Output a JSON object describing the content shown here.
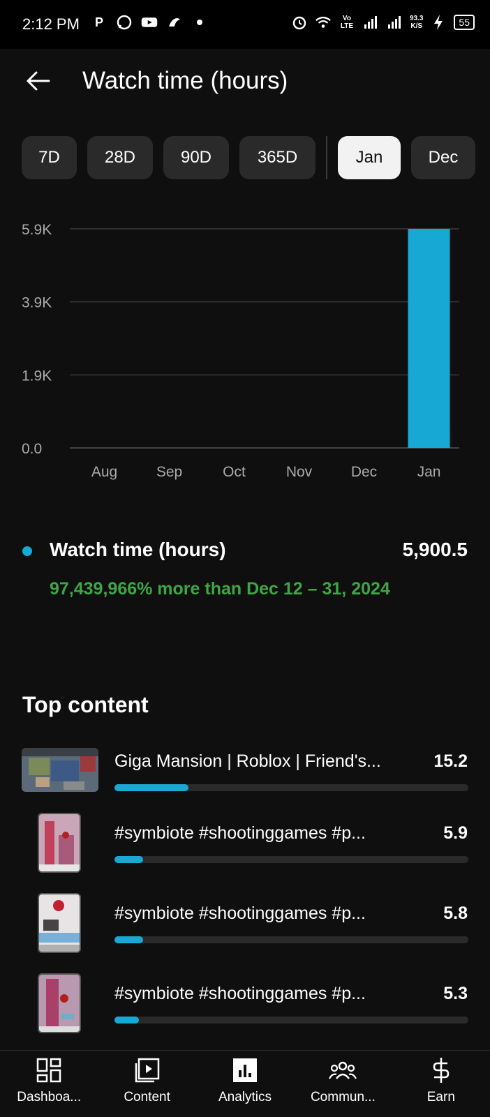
{
  "status_bar": {
    "time": "2:12 PM",
    "left_icons": [
      "parking-icon",
      "whatsapp-icon",
      "youtube-icon",
      "bird-icon",
      "dot-icon"
    ],
    "net_speed_value": "93.3",
    "net_speed_unit": "K/S",
    "volte": "Vo LTE",
    "battery": "55"
  },
  "header": {
    "title": "Watch time (hours)"
  },
  "periods": [
    {
      "label": "7D",
      "selected": false
    },
    {
      "label": "28D",
      "selected": false
    },
    {
      "label": "90D",
      "selected": false
    },
    {
      "label": "365D",
      "selected": false
    },
    {
      "label": "Jan",
      "selected": true
    },
    {
      "label": "Dec",
      "selected": false
    }
  ],
  "chart_data": {
    "type": "bar",
    "categories": [
      "Aug",
      "Sep",
      "Oct",
      "Nov",
      "Dec",
      "Jan"
    ],
    "values": [
      0,
      0,
      0,
      0,
      0,
      5900.5
    ],
    "y_ticks": [
      "0.0",
      "1.9K",
      "3.9K",
      "5.9K"
    ],
    "y_tick_values": [
      0,
      1966.8,
      3933.7,
      5900.5
    ],
    "ylim": [
      0,
      5900.5
    ],
    "grid": true,
    "bar_color": "#17a8d3"
  },
  "summary": {
    "label": "Watch time (hours)",
    "value": "5,900.5",
    "comparison": "97,439,966% more than Dec 12 – 31, 2024",
    "dot_color": "#17a8d3",
    "comparison_color": "#3ea645"
  },
  "top_content": {
    "title": "Top content",
    "items": [
      {
        "title": "Giga Mansion | Roblox | Friend's...",
        "value": "15.2",
        "fraction": 0.21,
        "thumb": "wide"
      },
      {
        "title": "#symbiote #shootinggames #p...",
        "value": "5.9",
        "fraction": 0.08,
        "thumb": "short"
      },
      {
        "title": "#symbiote #shootinggames #p...",
        "value": "5.8",
        "fraction": 0.08,
        "thumb": "short"
      },
      {
        "title": "#symbiote #shootinggames #p...",
        "value": "5.3",
        "fraction": 0.07,
        "thumb": "short"
      }
    ]
  },
  "bottom_nav": {
    "items": [
      {
        "label": "Dashboa...",
        "icon": "dashboard-icon"
      },
      {
        "label": "Content",
        "icon": "content-icon"
      },
      {
        "label": "Analytics",
        "icon": "analytics-icon"
      },
      {
        "label": "Commun...",
        "icon": "community-icon"
      },
      {
        "label": "Earn",
        "icon": "earn-icon"
      }
    ]
  }
}
